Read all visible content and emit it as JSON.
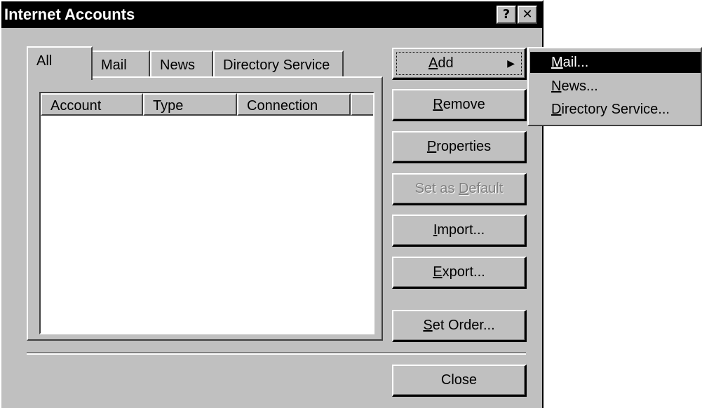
{
  "window": {
    "title": "Internet Accounts",
    "help_glyph": "?",
    "close_glyph": "✕"
  },
  "tabs": [
    {
      "label": "All",
      "active": true
    },
    {
      "label": "Mail"
    },
    {
      "label": "News"
    },
    {
      "label": "Directory Service"
    }
  ],
  "list": {
    "columns": [
      "Account",
      "Type",
      "Connection"
    ]
  },
  "buttons": {
    "add": {
      "label": "Add",
      "mnemonic": "A",
      "rest": "dd"
    },
    "remove": {
      "mnemonic": "R",
      "rest": "emove"
    },
    "properties": {
      "mnemonic": "P",
      "rest": "roperties"
    },
    "set_default": {
      "pre": "Set as ",
      "mnemonic": "D",
      "rest": "efault",
      "disabled": true
    },
    "import": {
      "mnemonic": "I",
      "rest": "mport..."
    },
    "export": {
      "mnemonic": "E",
      "rest": "xport..."
    },
    "set_order": {
      "mnemonic": "S",
      "rest": "et Order..."
    },
    "close": {
      "label": "Close"
    }
  },
  "add_menu": {
    "items": [
      {
        "mnemonic": "M",
        "rest": "ail...",
        "selected": true
      },
      {
        "mnemonic": "N",
        "rest": "ews..."
      },
      {
        "mnemonic": "D",
        "rest": "irectory Service..."
      }
    ]
  },
  "colors": {
    "face": "#c0c0c0",
    "titlebar": "#000000",
    "highlight": "#000000",
    "disabled_text": "#808080"
  }
}
